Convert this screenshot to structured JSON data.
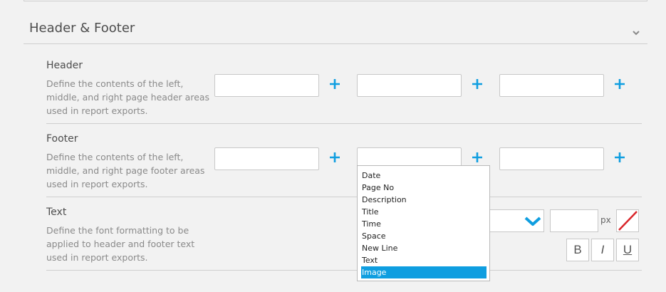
{
  "section": {
    "title": "Header & Footer",
    "collapse_icon": "chevron-down-icon"
  },
  "header_row": {
    "title": "Header",
    "description": "Define the contents of the left, middle, and right page header areas used in report exports.",
    "fields": [
      {
        "value": "",
        "plus_icon": "plus-icon"
      },
      {
        "value": "",
        "plus_icon": "plus-icon"
      },
      {
        "value": "",
        "plus_icon": "plus-icon"
      }
    ]
  },
  "footer_row": {
    "title": "Footer",
    "description": "Define the contents of the left, middle, and right page footer areas used in report exports.",
    "fields": [
      {
        "value": "",
        "plus_icon": "plus-icon"
      },
      {
        "value": "",
        "plus_icon": "plus-icon"
      },
      {
        "value": "",
        "plus_icon": "plus-icon"
      }
    ]
  },
  "insert_menu": {
    "items": [
      "Date",
      "Page No",
      "Description",
      "Title",
      "Time",
      "Space",
      "New Line",
      "Text",
      "Image"
    ],
    "selected": "Image"
  },
  "text_row": {
    "title": "Text",
    "description": "Define the font formatting to be applied to header and footer text used in report exports.",
    "font_size_value": "",
    "size_unit": "px",
    "bold_label": "B",
    "italic_label": "I",
    "underline_label": "U"
  },
  "colors": {
    "accent": "#0f9ee0",
    "no_color_slash": "#d9262b"
  }
}
